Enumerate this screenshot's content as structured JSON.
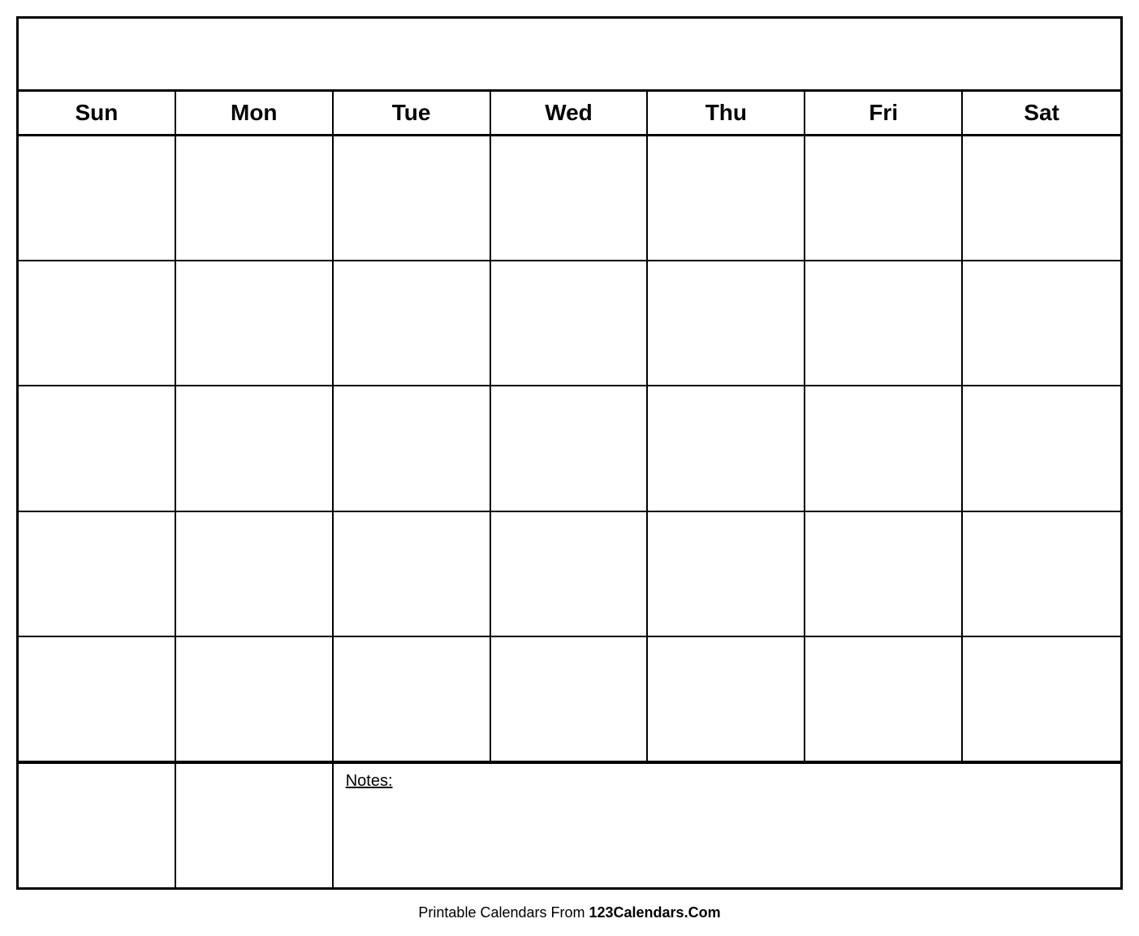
{
  "calendar": {
    "title": "",
    "days": [
      "Sun",
      "Mon",
      "Tue",
      "Wed",
      "Thu",
      "Fri",
      "Sat"
    ],
    "rows": 5,
    "notes_label": "Notes:"
  },
  "footer": {
    "text_normal": "Printable Calendars From ",
    "text_bold": "123Calendars.Com"
  }
}
